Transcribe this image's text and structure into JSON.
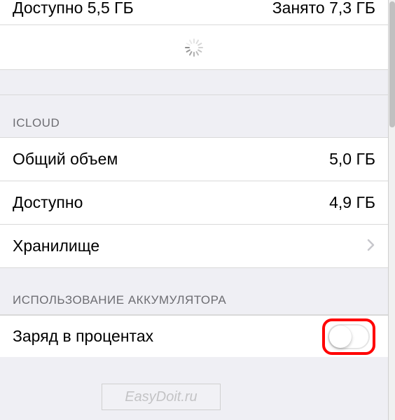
{
  "storage": {
    "available_label": "Доступно",
    "available_value": "5,5 ГБ",
    "used_label": "Занято",
    "used_value": "7,3 ГБ"
  },
  "icloud": {
    "header": "ICLOUD",
    "total_label": "Общий объем",
    "total_value": "5,0 ГБ",
    "available_label": "Доступно",
    "available_value": "4,9 ГБ",
    "storage_label": "Хранилище"
  },
  "battery": {
    "header": "ИСПОЛЬЗОВАНИЕ АККУМУЛЯТОРА",
    "percent_label": "Заряд в процентах"
  },
  "watermark": "EasyDoit.ru"
}
